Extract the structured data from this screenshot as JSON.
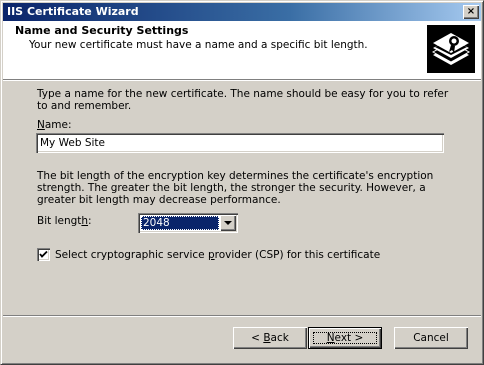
{
  "window": {
    "title": "IIS Certificate Wizard",
    "close_glyph": "×"
  },
  "header": {
    "title": "Name and Security Settings",
    "subtitle": "Your new certificate must have a name and a specific bit length.",
    "icon": "certificate-wizard-icon"
  },
  "form": {
    "intro": "Type a name for the new certificate. The name should be easy for you to refer to and remember.",
    "name_label_mnemonic": "N",
    "name_label_rest": "ame:",
    "name_value": "My Web Site",
    "description": "The bit length of the encryption key determines the certificate's encryption strength. The greater the bit length, the stronger the security.  However, a greater bit length may decrease performance.",
    "bit_length_label_pre": "Bit lengt",
    "bit_length_label_mnemonic": "h",
    "bit_length_label_post": ":",
    "bit_length_value": "2048",
    "csp_checked": true,
    "csp_label_pre": "Select cryptographic service ",
    "csp_label_mnemonic": "p",
    "csp_label_post": "rovider (CSP) for this certificate"
  },
  "buttons": {
    "back_prefix": "< ",
    "back_mnemonic": "B",
    "back_rest": "ack",
    "next_mnemonic": "N",
    "next_rest": "ext >",
    "cancel": "Cancel"
  },
  "colors": {
    "face": "#d4d0c8",
    "title_active": "#0a246a",
    "selection": "#0a246a"
  }
}
